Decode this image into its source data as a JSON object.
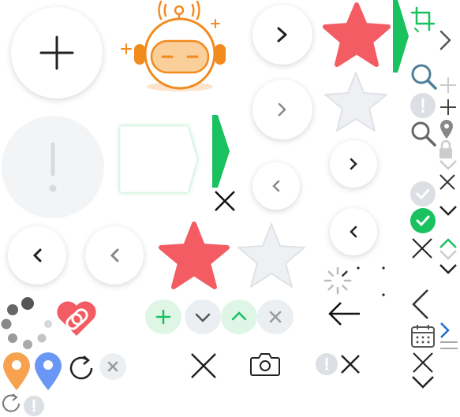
{
  "palette": {
    "red_star": "#f25c62",
    "gray_star": "#eef0f3",
    "green": "#19c15f",
    "green_light": "#dff6e7",
    "gray_light": "#eceff2",
    "gray_icon": "#9aa0a6",
    "dark": "#222222",
    "orange": "#f28a1e",
    "blue_pin": "#6a97f5",
    "teal_search": "#4e7f99"
  },
  "icons": [
    "plus-icon",
    "robot-mascot-icon",
    "chevron-right-icon",
    "star-icon",
    "crop-icon",
    "alert-icon",
    "arrow-tag-icon",
    "close-icon",
    "chevron-left-icon",
    "loading-spinner-icon",
    "heart-link-icon",
    "map-pin-icon",
    "refresh-icon",
    "plus-small-icon",
    "chevron-down-icon",
    "chevron-up-icon",
    "camera-icon",
    "arrow-left-icon",
    "search-icon",
    "lock-icon",
    "check-icon",
    "calendar-icon",
    "menu-lines-icon"
  ]
}
